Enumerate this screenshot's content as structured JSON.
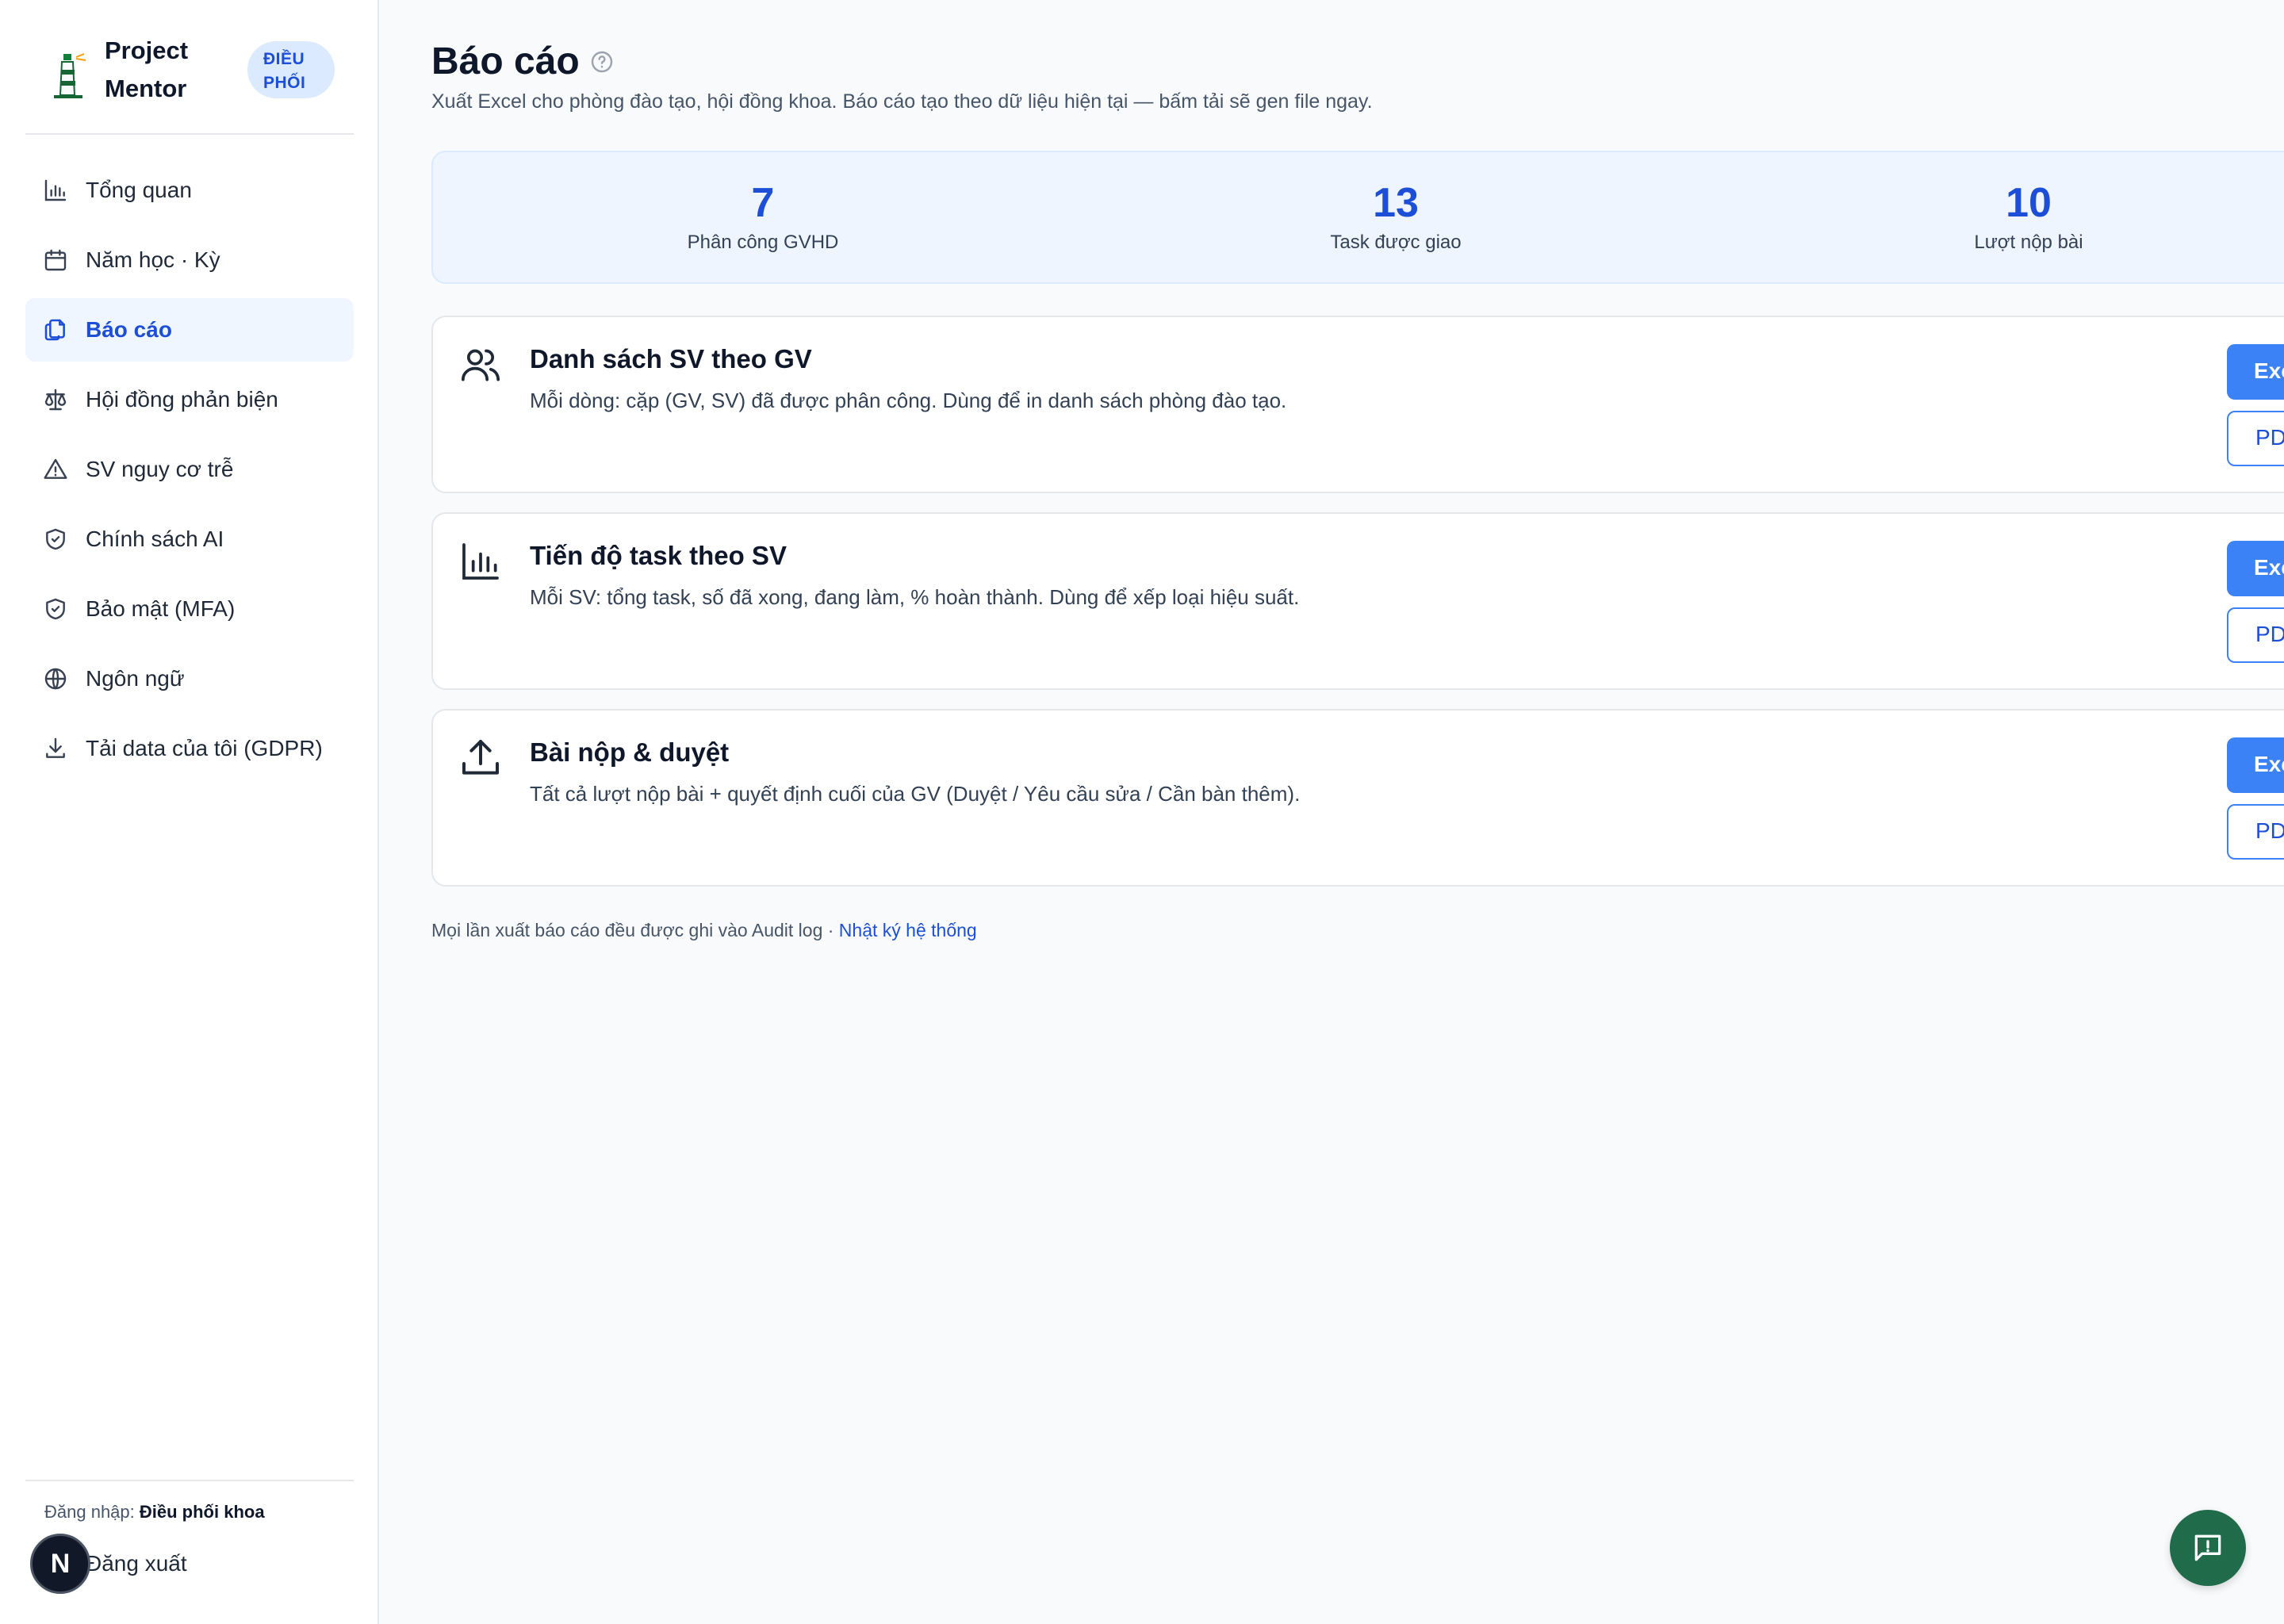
{
  "brand": {
    "name": "Project Mentor",
    "badge": "ĐIỀU PHỐI"
  },
  "sidebar": {
    "items": [
      {
        "label": "Tổng quan",
        "icon": "bar-chart-icon"
      },
      {
        "label": "Năm học · Kỳ",
        "icon": "calendar-icon"
      },
      {
        "label": "Báo cáo",
        "icon": "copy-report-icon",
        "active": true
      },
      {
        "label": "Hội đồng phản biện",
        "icon": "scale-icon"
      },
      {
        "label": "SV nguy cơ trễ",
        "icon": "warning-icon"
      },
      {
        "label": "Chính sách AI",
        "icon": "shield-check-icon"
      },
      {
        "label": "Bảo mật (MFA)",
        "icon": "shield-check-icon"
      },
      {
        "label": "Ngôn ngữ",
        "icon": "globe-icon"
      },
      {
        "label": "Tải data của tôi (GDPR)",
        "icon": "download-icon"
      }
    ],
    "login_prefix": "Đăng nhập:",
    "login_role": "Điều phối khoa",
    "logout_label": "Đăng xuất",
    "avatar_letter": "N"
  },
  "page": {
    "title": "Báo cáo",
    "subtitle": "Xuất Excel cho phòng đào tạo, hội đồng khoa. Báo cáo tạo theo dữ liệu hiện tại — bấm tải sẽ gen file ngay."
  },
  "stats": [
    {
      "value": "7",
      "label": "Phân công GVHD"
    },
    {
      "value": "13",
      "label": "Task được giao"
    },
    {
      "value": "10",
      "label": "Lượt nộp bài"
    }
  ],
  "reports": [
    {
      "title": "Danh sách SV theo GV",
      "desc": "Mỗi dòng: cặp (GV, SV) đã được phân công. Dùng để in danh sách phòng đào tạo.",
      "icon": "users-icon",
      "excel_label": "Excel",
      "pdf_label": "PDF"
    },
    {
      "title": "Tiến độ task theo SV",
      "desc": "Mỗi SV: tổng task, số đã xong, đang làm, % hoàn thành. Dùng để xếp loại hiệu suất.",
      "icon": "bar-chart-icon",
      "excel_label": "Excel",
      "pdf_label": "PDF"
    },
    {
      "title": "Bài nộp & duyệt",
      "desc": "Tất cả lượt nộp bài + quyết định cuối của GV (Duyệt / Yêu cầu sửa / Cần bàn thêm).",
      "icon": "upload-icon",
      "excel_label": "Excel",
      "pdf_label": "PDF"
    }
  ],
  "footnote": {
    "text": "Mọi lần xuất báo cáo đều được ghi vào Audit log ·",
    "link": "Nhật ký hệ thống"
  },
  "colors": {
    "accent": "#3b82f6",
    "accent_dark": "#1d4ed8",
    "chat_fab": "#1f6b4a"
  }
}
